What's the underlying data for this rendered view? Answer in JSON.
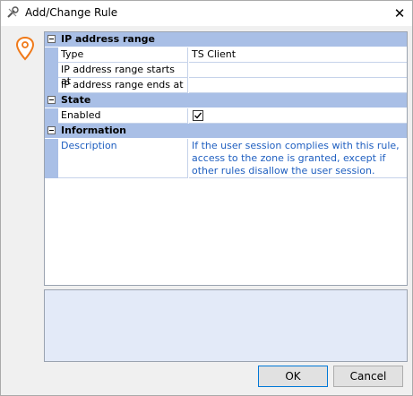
{
  "window": {
    "title": "Add/Change Rule"
  },
  "grid": {
    "categories": [
      {
        "label": "IP address range"
      },
      {
        "label": "State"
      },
      {
        "label": "Information"
      }
    ],
    "ip": [
      {
        "name": "Type",
        "value": "TS Client"
      },
      {
        "name": "IP address range starts at",
        "value": ""
      },
      {
        "name": "IP address range ends at",
        "value": ""
      }
    ],
    "state": [
      {
        "name": "Enabled",
        "checked": true
      }
    ],
    "info": [
      {
        "name": "Description",
        "value": "If the user session complies with this rule, access to the zone is granted, except if other rules disallow the user session."
      }
    ]
  },
  "buttons": {
    "ok": "OK",
    "cancel": "Cancel"
  },
  "colors": {
    "category_bg": "#a9bfe6",
    "description_text": "#1f5fc0",
    "panel_bg": "#e3eaf8"
  },
  "icons": {
    "title": "rule-tools-icon",
    "close": "close-icon",
    "pin": "location-pin-icon",
    "collapse": "minus-box-icon",
    "check": "checkmark-icon"
  }
}
